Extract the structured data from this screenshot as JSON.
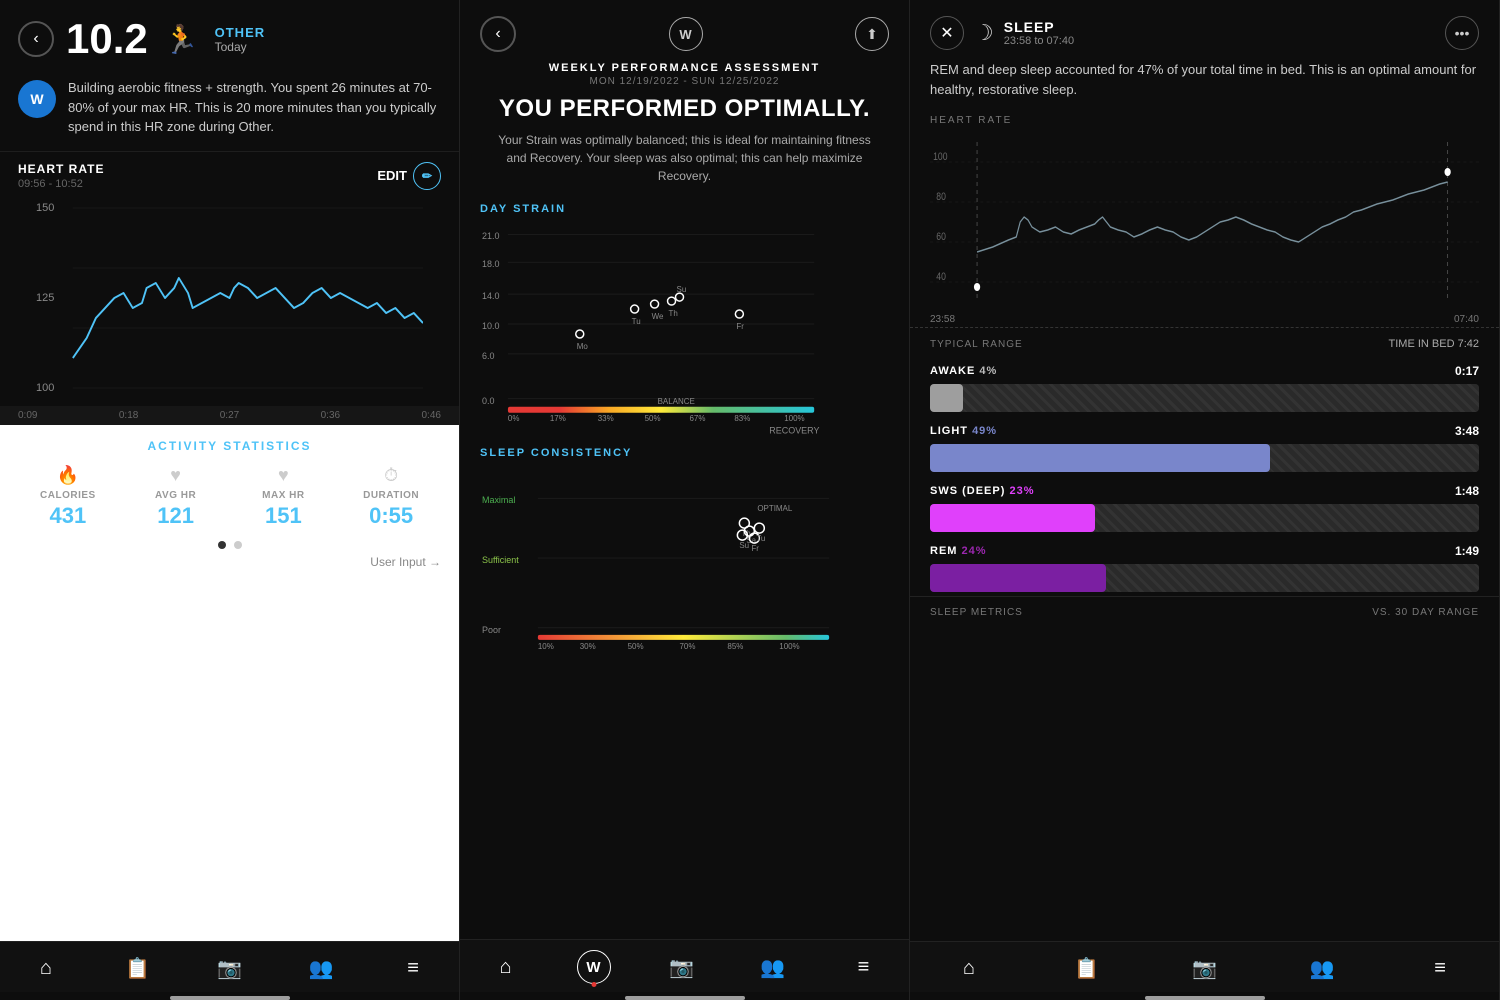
{
  "panel1": {
    "back_label": "‹",
    "score": "10.2",
    "activity_type": "OTHER",
    "activity_date": "Today",
    "avatar": "W",
    "description": "Building aerobic fitness + strength. You spent 26 minutes at 70-80% of your max HR. This is 20 more minutes than you typically spend in this HR zone during Other.",
    "heart_rate": {
      "title": "HEART RATE",
      "time_range": "09:56 - 10:52",
      "edit_label": "EDIT",
      "y_labels": [
        "150",
        "125",
        "100"
      ],
      "x_labels": [
        "0:09",
        "0:18",
        "0:27",
        "0:36",
        "0:46"
      ]
    },
    "activity_stats": {
      "title": "ACTIVITY STATISTICS",
      "calories": {
        "icon": "🔥",
        "label": "CALORIES",
        "value": "431"
      },
      "avg_hr": {
        "icon": "♥",
        "label": "AVG HR",
        "value": "121"
      },
      "max_hr": {
        "icon": "♥",
        "label": "MAX HR",
        "value": "151"
      },
      "duration": {
        "icon": "⏱",
        "label": "DURATION",
        "value": "0:55"
      },
      "user_input": "User Input →"
    },
    "nav_items": [
      "⌂",
      "📋",
      "📷",
      "👥",
      "≡"
    ]
  },
  "panel2": {
    "back_label": "‹",
    "logo": "W",
    "share_icon": "⬆",
    "title": "WEEKLY PERFORMANCE ASSESSMENT",
    "date_range": "MON 12/19/2022 - SUN 12/25/2022",
    "headline": "YOU PERFORMED OPTIMALLY.",
    "description": "Your Strain was optimally balanced; this is ideal for maintaining fitness and Recovery. Your sleep was also optimal; this can help maximize Recovery.",
    "day_strain_label": "DAY STRAIN",
    "day_strain_y": [
      "21.0",
      "18.0",
      "14.0",
      "10.0",
      "6.0",
      "0.0"
    ],
    "day_strain_x_pct": [
      "0%",
      "17%",
      "33%",
      "50%",
      "67%",
      "83%",
      "100%"
    ],
    "day_strain_x_bottom": "RECOVERY",
    "balance_label": "BALANCE",
    "sleep_consistency_label": "SLEEP CONSISTENCY",
    "sc_y": [
      "Maximal",
      "Sufficient",
      "Poor"
    ],
    "sc_x_pct": [
      "10%",
      "30%",
      "50%",
      "70%",
      "85%",
      "100%"
    ],
    "nav_items": [
      "⌂",
      "W",
      "📷",
      "👥",
      "≡"
    ]
  },
  "panel3": {
    "close_icon": "✕",
    "sleep_moon": "☽",
    "title": "SLEEP",
    "time_range": "23:58 to 07:40",
    "more_icon": "•••",
    "description": "REM and deep sleep accounted for 47% of your total time in bed. This is an optimal amount for healthy, restorative sleep.",
    "heart_rate_label": "HEART RATE",
    "chart_start": "23:58",
    "chart_end": "07:40",
    "typical_range": "TYPICAL RANGE",
    "time_in_bed_label": "TIME IN BED",
    "time_in_bed_value": "7:42",
    "stages": [
      {
        "name": "AWAKE",
        "pct": "4%",
        "pct_color": "#bbb",
        "duration": "0:17",
        "bar_color": "#9e9e9e",
        "bar_width_pct": 6
      },
      {
        "name": "LIGHT",
        "pct": "49%",
        "pct_color": "#7986cb",
        "duration": "3:48",
        "bar_color": "#7986cb",
        "bar_width_pct": 62
      },
      {
        "name": "SWS (DEEP)",
        "pct": "23%",
        "pct_color": "#e040fb",
        "duration": "1:48",
        "bar_color": "#e040fb",
        "bar_width_pct": 30
      },
      {
        "name": "REM",
        "pct": "24%",
        "pct_color": "#9c27b0",
        "duration": "1:49",
        "bar_color": "#9c27b0",
        "bar_width_pct": 32
      }
    ],
    "sleep_metrics_label": "SLEEP METRICS",
    "vs_range_label": "VS. 30 DAY RANGE",
    "nav_items": [
      "⌂",
      "📋",
      "📷",
      "👥",
      "≡"
    ]
  }
}
